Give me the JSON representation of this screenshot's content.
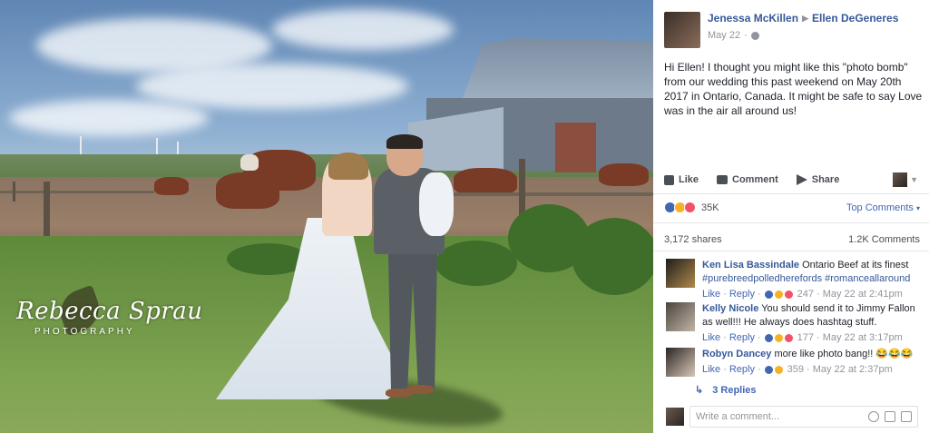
{
  "photo": {
    "watermark_name": "Rebecca Sprau",
    "watermark_sub": "PHOTOGRAPHY"
  },
  "post": {
    "author": "Jenessa McKillen",
    "target": "Ellen DeGeneres",
    "date": "May 22",
    "separator": "·",
    "text": "Hi Ellen! I thought you might like this \"photo bomb\" from our wedding this past weekend on May 20th 2017 in Ontario, Canada. It might be safe to say Love was in the air all around us!"
  },
  "actions": {
    "like": "Like",
    "comment": "Comment",
    "share": "Share"
  },
  "stats": {
    "reaction_count": "35K",
    "top_comments": "Top Comments",
    "shares": "3,172 shares",
    "comments": "1.2K Comments"
  },
  "comments": [
    {
      "author": "Ken Lisa Bassindale",
      "text": "Ontario Beef at its finest",
      "hashtags": "#purebreedpolledherefords #romanceallaround",
      "like": "Like",
      "reply": "Reply",
      "count": "247",
      "time": "May 22 at 2:41pm"
    },
    {
      "author": "Kelly Nicole",
      "text": "You should send it to Jimmy Fallon as well!!! He always does hashtag stuff.",
      "like": "Like",
      "reply": "Reply",
      "count": "177",
      "time": "May 22 at 3:17pm"
    },
    {
      "author": "Robyn Dancey",
      "text": "more like photo bang!! 😂😂😂",
      "like": "Like",
      "reply": "Reply",
      "count": "359",
      "time": "May 22 at 2:37pm"
    }
  ],
  "replies_label": "3 Replies",
  "write_comment_placeholder": "Write a comment..."
}
